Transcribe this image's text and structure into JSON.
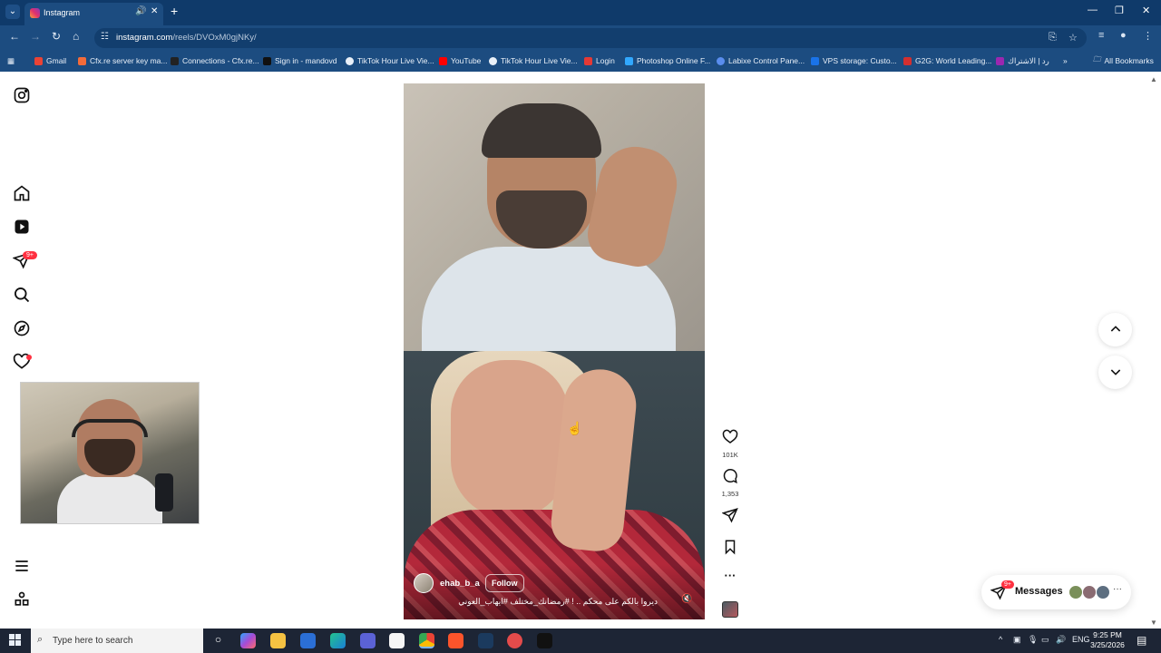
{
  "browser": {
    "tab_title": "Instagram",
    "url_host": "instagram.com",
    "url_path": "/reels/DVOxM0gjNKy/",
    "bookmarks": [
      {
        "label": "Gmail",
        "color": "#ea4335"
      },
      {
        "label": "Cfx.re server key ma...",
        "color": "#f26b3a"
      },
      {
        "label": "Connections - Cfx.re...",
        "color": "#222222"
      },
      {
        "label": "Sign in - mandovd",
        "color": "#111111"
      },
      {
        "label": "TikTok Hour Live Vie...",
        "color": "#e9f0f8"
      },
      {
        "label": "YouTube",
        "color": "#ff0000"
      },
      {
        "label": "TikTok Hour Live Vie...",
        "color": "#e9f0f8"
      },
      {
        "label": "Login",
        "color": "#e53935"
      },
      {
        "label": "Photoshop Online F...",
        "color": "#31a8ff"
      },
      {
        "label": "Labixe Control Pane...",
        "color": "#5a8dee"
      },
      {
        "label": "VPS storage: Custo...",
        "color": "#1a73e8"
      },
      {
        "label": "G2G: World Leading...",
        "color": "#d32f2f"
      },
      {
        "label": "رد | الاشتراك",
        "color": "#9c27b0"
      }
    ],
    "more_bookmarks": "»",
    "all_bookmarks": "All Bookmarks"
  },
  "sidebar": {
    "notifications_badge": "9+"
  },
  "reel": {
    "username": "ehab_b_a",
    "follow_label": "Follow",
    "caption": "ديروا بالكم على محكم .. ! #رمضانك_مختلف #ايهاب_العوني"
  },
  "actions": {
    "likes": "101K",
    "comments": "1,353"
  },
  "messages": {
    "label": "Messages",
    "badge": "9+"
  },
  "taskbar": {
    "search_placeholder": "Type here to search",
    "language": "ENG",
    "time": "9:25 PM",
    "date": "3/25/2026"
  },
  "colors": {
    "chrome_dark": "#0f3a6a",
    "chrome": "#1c4c80",
    "ig_red": "#ff3040"
  }
}
